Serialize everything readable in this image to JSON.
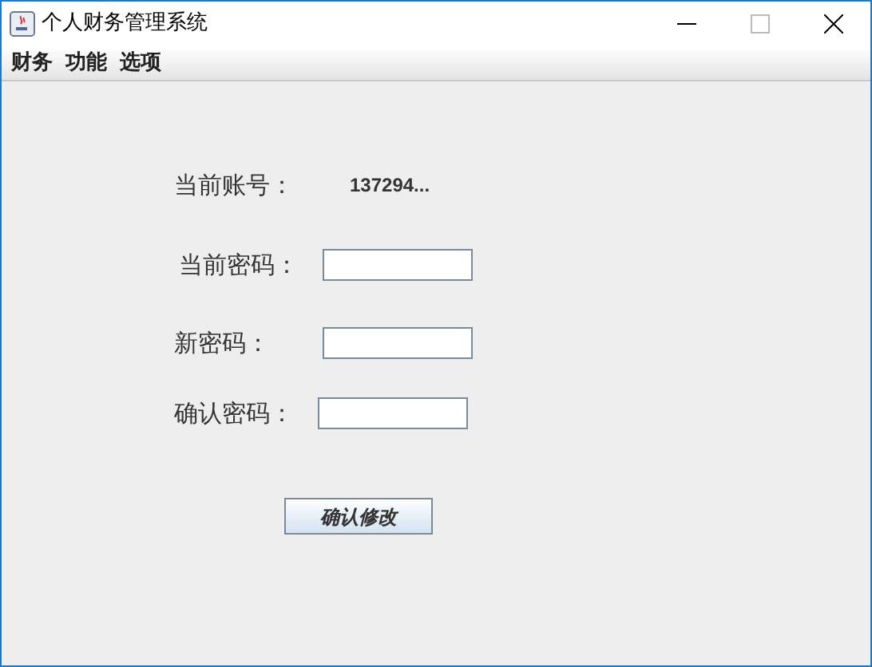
{
  "window": {
    "title": "个人财务管理系统"
  },
  "menu": [
    "财务",
    "功能",
    "选项"
  ],
  "account": {
    "label": "当前账号：",
    "value": "137294..."
  },
  "fields": [
    {
      "label": "当前密码："
    },
    {
      "label": "新密码："
    },
    {
      "label": "确认密码："
    }
  ],
  "button": "确认修改"
}
